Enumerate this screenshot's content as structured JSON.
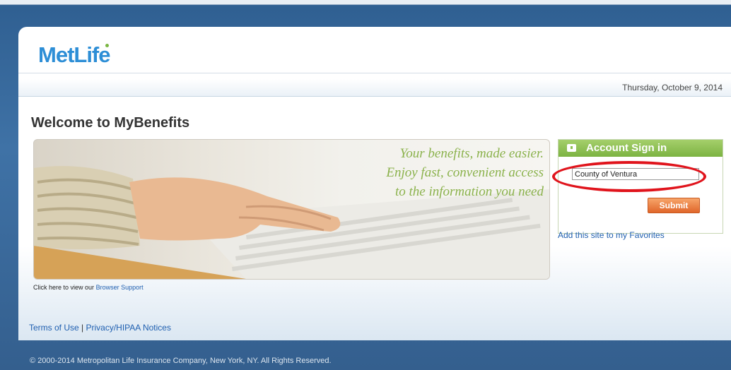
{
  "header": {
    "logo_text": "MetLife",
    "date": "Thursday, October 9, 2014"
  },
  "main": {
    "title": "Welcome to MyBenefits",
    "banner": {
      "tagline_lines": [
        "Your benefits, made easier.",
        "Enjoy fast, convenient access",
        "to the information you need"
      ]
    },
    "browser_support": {
      "prefix": "Click here to view our",
      "link": "Browser Support"
    }
  },
  "signin": {
    "title": "Account Sign in",
    "input_value": "County of Ventura",
    "submit_label": "Submit",
    "favorites_link": "Add this site to my Favorites"
  },
  "footer": {
    "terms": "Terms of Use",
    "separator": "|",
    "privacy": "Privacy/HIPAA Notices",
    "copyright": "©  2000-2014  Metropolitan Life Insurance Company, New York, NY. All Rights Reserved."
  },
  "colors": {
    "brand_blue": "#2d8ed6",
    "accent_green": "#7cb342",
    "button_orange": "#e0662a",
    "highlight_red": "#e0141c",
    "link_blue": "#1f5fb0"
  }
}
